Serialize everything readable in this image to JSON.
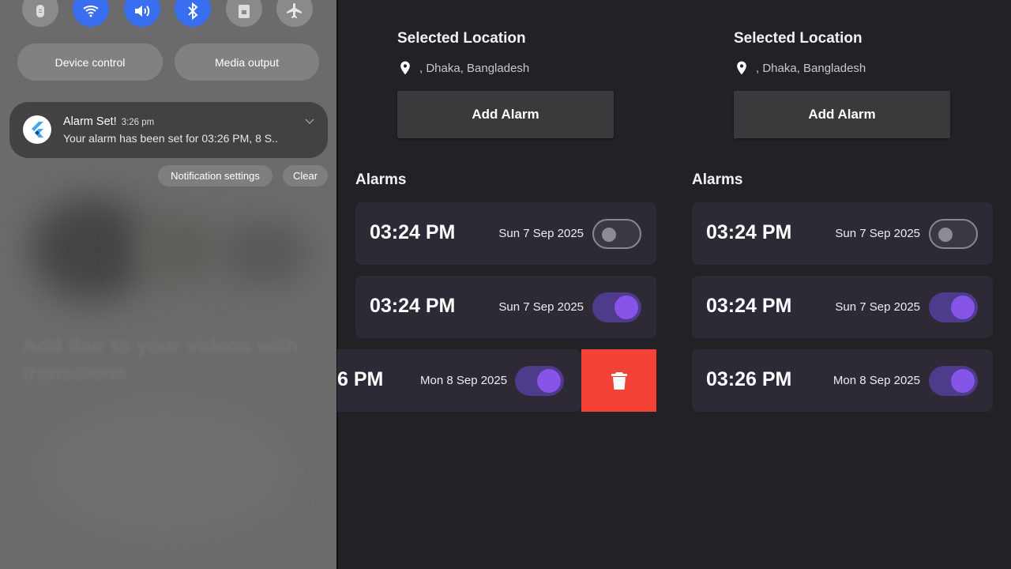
{
  "notification_shade": {
    "quick_settings": [
      {
        "icon": "bug-icon",
        "state": "off"
      },
      {
        "icon": "wifi-icon",
        "state": "on"
      },
      {
        "icon": "volume-icon",
        "state": "on"
      },
      {
        "icon": "bluetooth-icon",
        "state": "on"
      },
      {
        "icon": "lock-icon",
        "state": "off"
      },
      {
        "icon": "airplane-icon",
        "state": "off"
      }
    ],
    "device_control_label": "Device control",
    "media_output_label": "Media output",
    "notification": {
      "icon": "flutter-icon",
      "title": "Alarm Set!",
      "time": "3:26 pm",
      "body": "Your alarm has been set for 03:26 PM, 8 S.."
    },
    "notification_settings_label": "Notification settings",
    "clear_label": "Clear"
  },
  "panel_left": {
    "selected_location_title": "Selected Location",
    "location": ", Dhaka, Bangladesh",
    "add_alarm_label": "Add Alarm",
    "alarms_title": "Alarms",
    "alarms": [
      {
        "time": "03:24 PM",
        "date": "Sun 7 Sep 2025",
        "enabled": false
      },
      {
        "time": "03:24 PM",
        "date": "Sun 7 Sep 2025",
        "enabled": true
      },
      {
        "time": "6 PM",
        "date": "Mon 8 Sep 2025",
        "enabled": true
      }
    ]
  },
  "panel_right": {
    "selected_location_title": "Selected Location",
    "location": ", Dhaka, Bangladesh",
    "add_alarm_label": "Add Alarm",
    "alarms_title": "Alarms",
    "alarms": [
      {
        "time": "03:24 PM",
        "date": "Sun 7 Sep 2025",
        "enabled": false
      },
      {
        "time": "03:24 PM",
        "date": "Sun 7 Sep 2025",
        "enabled": true
      },
      {
        "time": "03:26 PM",
        "date": "Mon 8 Sep 2025",
        "enabled": true
      }
    ]
  },
  "colors": {
    "accent": "#8655e8",
    "toggle_track_on": "#4f3b8c",
    "delete": "#f44336",
    "quick_setting_on": "#3a6ef0"
  }
}
